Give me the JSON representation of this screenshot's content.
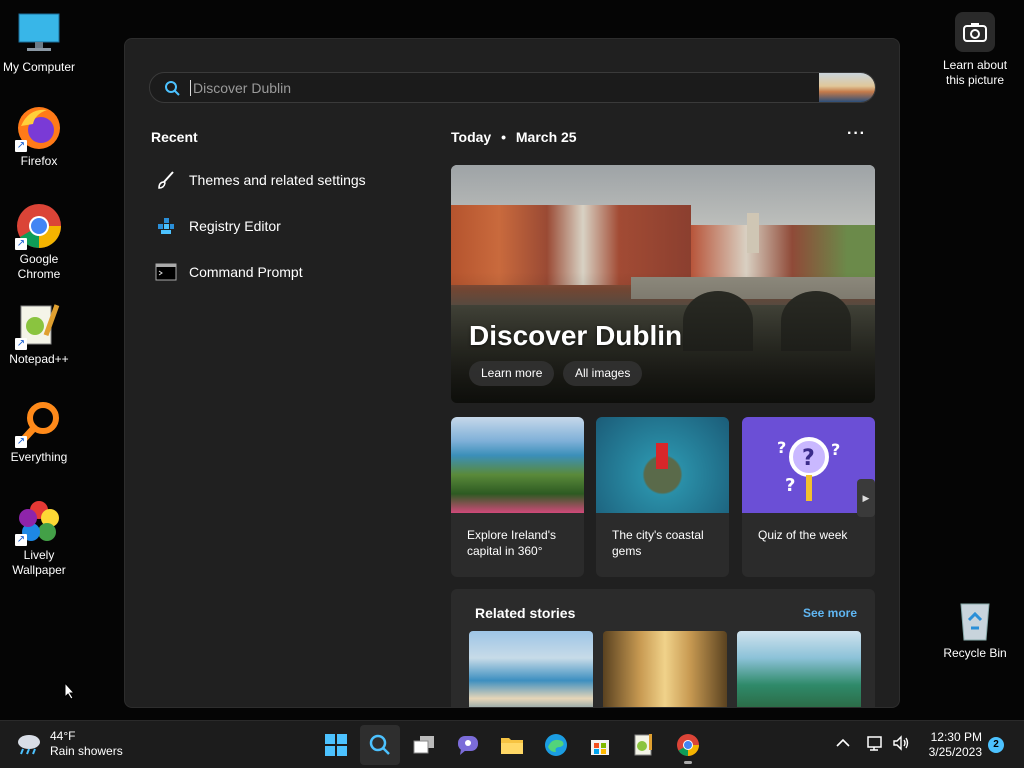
{
  "desktop": {
    "icons": [
      {
        "label": "My Computer"
      },
      {
        "label": "Firefox"
      },
      {
        "label": "Google Chrome"
      },
      {
        "label": "Notepad++"
      },
      {
        "label": "Everything"
      },
      {
        "label": "Lively Wallpaper"
      }
    ],
    "right_icons": {
      "learn_about": "Learn about this picture",
      "recycle_bin": "Recycle Bin"
    }
  },
  "search": {
    "placeholder": "Discover Dublin",
    "value": ""
  },
  "recent": {
    "title": "Recent",
    "items": [
      {
        "label": "Themes and related settings",
        "icon": "paintbrush-icon"
      },
      {
        "label": "Registry Editor",
        "icon": "registry-editor-icon"
      },
      {
        "label": "Command Prompt",
        "icon": "command-prompt-icon"
      }
    ]
  },
  "today": {
    "label": "Today",
    "separator": "•",
    "date": "March 25",
    "more": "···"
  },
  "hero": {
    "title": "Discover Dublin",
    "learn_more": "Learn more",
    "all_images": "All images"
  },
  "cards": [
    {
      "caption": "Explore Ireland's capital in 360°"
    },
    {
      "caption": "The city's coastal gems"
    },
    {
      "caption": "Quiz of the week"
    }
  ],
  "related": {
    "title": "Related stories",
    "see_more": "See more"
  },
  "taskbar": {
    "weather_temp": "44°F",
    "weather_desc": "Rain showers",
    "time": "12:30 PM",
    "date": "3/25/2023",
    "notifications": "2"
  },
  "colors": {
    "accent": "#60b6f2",
    "panel_bg": "#202020",
    "card_bg": "#2b2b2b",
    "taskbar_bg": "#1c1c1c"
  }
}
